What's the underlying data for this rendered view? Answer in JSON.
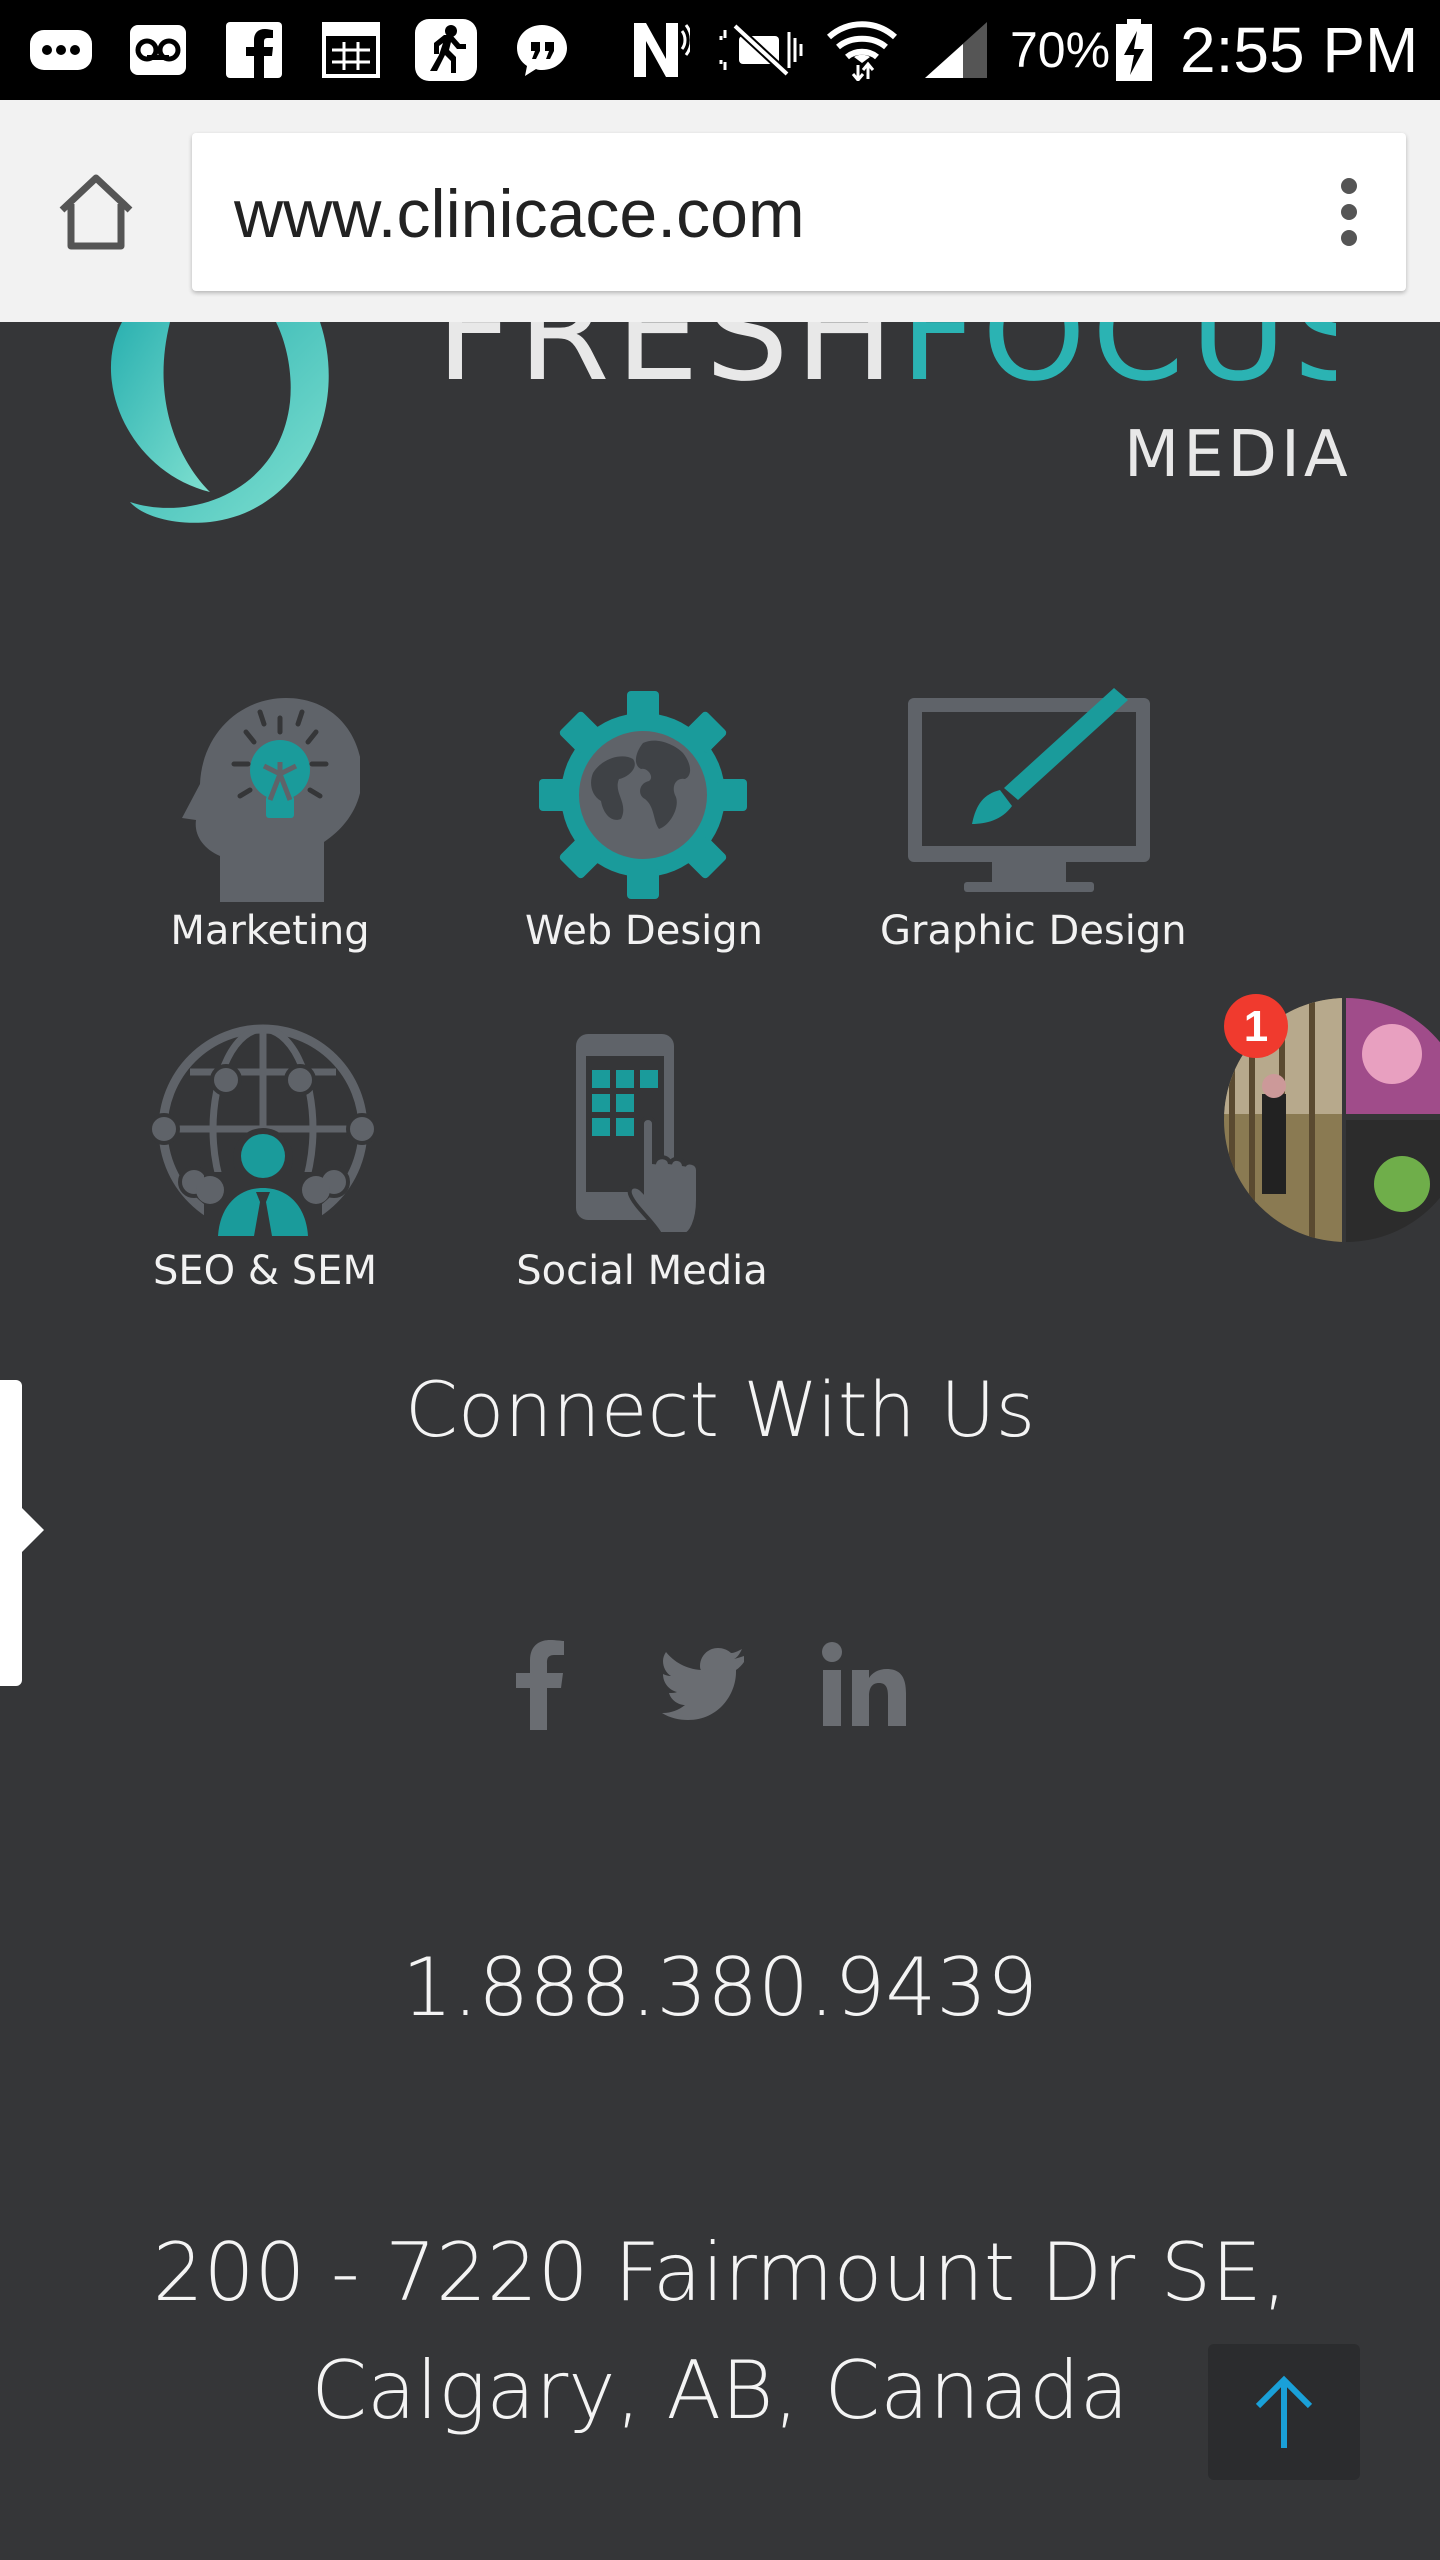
{
  "status_bar": {
    "battery": "70%",
    "time": "2:55 PM",
    "icons": [
      "voicemail-dots-icon",
      "voicemail-icon",
      "facebook-icon",
      "calendar-icon",
      "running-icon",
      "quote-icon",
      "nfc-icon",
      "mute-icon",
      "wifi-icon",
      "signal-icon",
      "battery-charging-icon"
    ]
  },
  "browser": {
    "url": "www.clinicace.com",
    "icons": [
      "home-icon",
      "overflow-menu-icon"
    ]
  },
  "logo": {
    "text_fresh": "FRESH",
    "text_focus": "FOCUS",
    "text_media": "MEDIA"
  },
  "services": [
    {
      "label": "Marketing",
      "icon": "lightbulb-head-icon"
    },
    {
      "label": "Web Design",
      "icon": "globe-gear-icon"
    },
    {
      "label": "Graphic Design",
      "icon": "monitor-brush-icon"
    },
    {
      "label": "SEO & SEM",
      "icon": "network-globe-icon"
    },
    {
      "label": "Social Media",
      "icon": "phone-touch-icon"
    }
  ],
  "chat_head": {
    "badge_count": "1"
  },
  "connect": {
    "heading": "Connect With Us",
    "social_icons": [
      "facebook-icon",
      "twitter-icon",
      "linkedin-icon"
    ]
  },
  "contact": {
    "phone": "1.888.380.9439",
    "address_line1": "200 - 7220 Fairmount Dr SE,",
    "address_line2": "Calgary, AB, Canada"
  },
  "colors": {
    "background": "#353638",
    "accent": "#1a9b9b",
    "icon_gray": "#5f6369",
    "text": "#f4f4f4",
    "badge": "#f03a2e",
    "scroll_arrow": "#1aa0d8"
  }
}
